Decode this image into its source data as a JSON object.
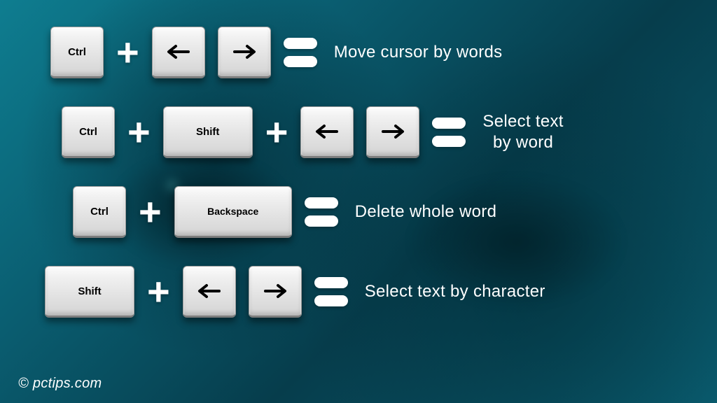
{
  "rows": [
    {
      "keys": [
        "Ctrl"
      ],
      "hasArrows": true,
      "desc": "Move cursor by words"
    },
    {
      "keys": [
        "Ctrl",
        "Shift"
      ],
      "hasArrows": true,
      "desc": "Select text\nby word"
    },
    {
      "keys": [
        "Ctrl",
        "Backspace"
      ],
      "hasArrows": false,
      "desc": "Delete whole word"
    },
    {
      "keys": [
        "Shift"
      ],
      "hasArrows": true,
      "desc": "Select text by character"
    }
  ],
  "credit": "© pctips.com",
  "icons": {
    "arrowLeft": "←",
    "arrowRight": "→"
  }
}
